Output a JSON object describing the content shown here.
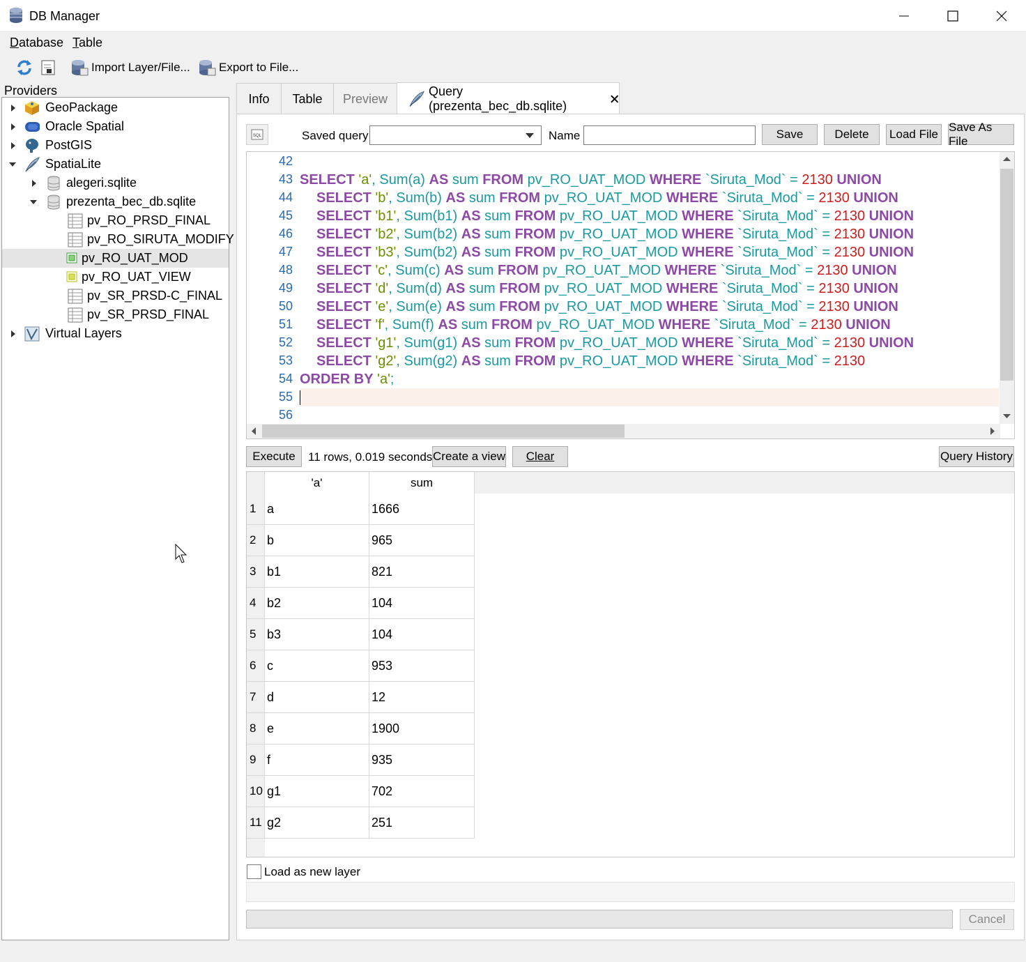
{
  "window": {
    "title": "DB Manager"
  },
  "menu": [
    {
      "label_u": "D",
      "label_rest": "atabase"
    },
    {
      "label_u": "T",
      "label_rest": "able"
    }
  ],
  "toolbar": {
    "import_label": "Import Layer/File...",
    "export_label": "Export to File..."
  },
  "providers": {
    "label": "Providers",
    "items": [
      {
        "label": "GeoPackage",
        "icon": "geopackage-icon"
      },
      {
        "label": "Oracle Spatial",
        "icon": "oracle-icon"
      },
      {
        "label": "PostGIS",
        "icon": "postgis-elephant-icon"
      },
      {
        "label": "SpatiaLite",
        "icon": "feather-icon"
      },
      {
        "label": "alegeri.sqlite",
        "icon": "database-icon"
      },
      {
        "label": "prezenta_bec_db.sqlite",
        "icon": "database-icon"
      },
      {
        "label": "pv_RO_PRSD_FINAL",
        "icon": "table-icon"
      },
      {
        "label": "pv_RO_SIRUTA_MODIFY",
        "icon": "table-icon"
      },
      {
        "label": "pv_RO_UAT_MOD",
        "icon": "polygon-layer-icon"
      },
      {
        "label": "pv_RO_UAT_VIEW",
        "icon": "polygon-layer-icon"
      },
      {
        "label": "pv_SR_PRSD-C_FINAL",
        "icon": "table-icon"
      },
      {
        "label": "pv_SR_PRSD_FINAL",
        "icon": "table-icon"
      },
      {
        "label": "Virtual Layers",
        "icon": "virtual-layers-icon"
      }
    ]
  },
  "tabs": [
    {
      "label": "Info"
    },
    {
      "label": "Table"
    },
    {
      "label": "Preview"
    },
    {
      "label": "Query (prezenta_bec_db.sqlite)"
    }
  ],
  "query_toolbar": {
    "saved_query_label": "Saved query",
    "saved_query_value": "",
    "name_label": "Name",
    "name_value": "",
    "save": "Save",
    "delete": "Delete",
    "load_file": "Load File",
    "save_as_file": "Save As File"
  },
  "editor": {
    "line_numbers": [
      "42",
      "43",
      "44",
      "45",
      "46",
      "47",
      "48",
      "49",
      "50",
      "51",
      "52",
      "53",
      "54",
      "55",
      "56"
    ],
    "select_kw": "SELECT",
    "sum_kw": "Sum(",
    "as_kw": "AS",
    "sum_alias": "sum",
    "from_kw": "FROM",
    "table_name": "pv_RO_UAT_MOD",
    "where_kw": "WHERE",
    "column": "`Siruta_Mod`",
    "eq": "=",
    "value": "2130",
    "union_kw": "UNION",
    "queries": [
      {
        "lit": "'a'",
        "col": "a"
      },
      {
        "lit": "'b'",
        "col": "b"
      },
      {
        "lit": "'b1'",
        "col": "b1"
      },
      {
        "lit": "'b2'",
        "col": "b2"
      },
      {
        "lit": "'b3'",
        "col": "b2"
      },
      {
        "lit": "'c'",
        "col": "c"
      },
      {
        "lit": "'d'",
        "col": "d"
      },
      {
        "lit": "'e'",
        "col": "e"
      },
      {
        "lit": "'f'",
        "col": "f"
      },
      {
        "lit": "'g1'",
        "col": "g1"
      },
      {
        "lit": "'g2'",
        "col": "g2"
      }
    ],
    "order_kw": "ORDER BY",
    "order_lit": "'a'",
    "semicolon": ";"
  },
  "actions": {
    "execute": "Execute",
    "status": "11 rows, 0.019 seconds",
    "create_view": "Create a view",
    "clear": "Clear",
    "query_history": "Query History"
  },
  "results": {
    "columns": [
      "'a'",
      "sum"
    ],
    "rows": [
      [
        "1",
        "a",
        "1666"
      ],
      [
        "2",
        "b",
        "965"
      ],
      [
        "3",
        "b1",
        "821"
      ],
      [
        "4",
        "b2",
        "104"
      ],
      [
        "5",
        "b3",
        "104"
      ],
      [
        "6",
        "c",
        "953"
      ],
      [
        "7",
        "d",
        "12"
      ],
      [
        "8",
        "e",
        "1900"
      ],
      [
        "9",
        "f",
        "935"
      ],
      [
        "10",
        "g1",
        "702"
      ],
      [
        "11",
        "g2",
        "251"
      ]
    ]
  },
  "footer": {
    "load_as_layer": "Load as new layer",
    "cancel": "Cancel"
  }
}
